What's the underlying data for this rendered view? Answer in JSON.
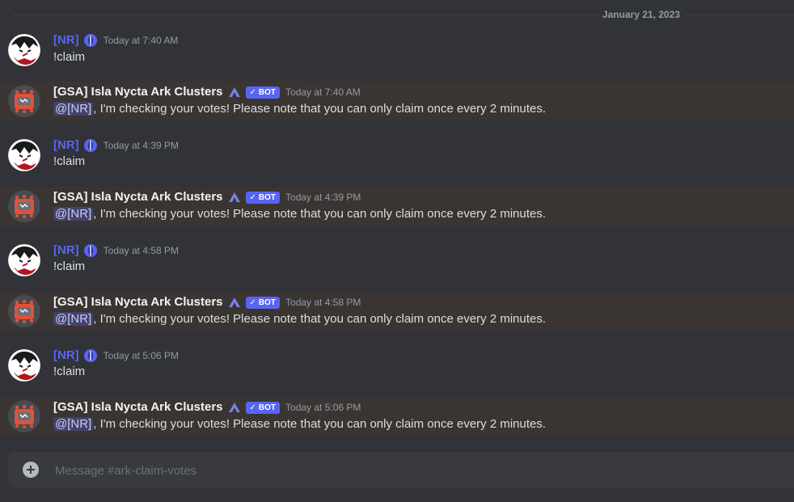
{
  "chat": {
    "date_divider": "January 21, 2023",
    "messages": [
      {
        "author": "[NR]",
        "time": "Today at 7:40 AM",
        "text": "!claim",
        "is_bot": false
      },
      {
        "author": "[GSA] Isla Nycta Ark Clusters",
        "bot_tag": "BOT",
        "time": "Today at 7:40 AM",
        "mention": "@[NR]",
        "text": ", I'm checking your votes! Please note that you can only claim once every 2 minutes.",
        "is_bot": true
      },
      {
        "author": "[NR]",
        "time": "Today at 4:39 PM",
        "text": "!claim",
        "is_bot": false
      },
      {
        "author": "[GSA] Isla Nycta Ark Clusters",
        "bot_tag": "BOT",
        "time": "Today at 4:39 PM",
        "mention": "@[NR]",
        "text": ", I'm checking your votes! Please note that you can only claim once every 2 minutes.",
        "is_bot": true
      },
      {
        "author": "[NR]",
        "time": "Today at 4:58 PM",
        "text": "!claim",
        "is_bot": false
      },
      {
        "author": "[GSA] Isla Nycta Ark Clusters",
        "bot_tag": "BOT",
        "time": "Today at 4:58 PM",
        "mention": "@[NR]",
        "text": ", I'm checking your votes! Please note that you can only claim once every 2 minutes.",
        "is_bot": true
      },
      {
        "author": "[NR]",
        "time": "Today at 5:06 PM",
        "text": "!claim",
        "is_bot": false
      },
      {
        "author": "[GSA] Isla Nycta Ark Clusters",
        "bot_tag": "BOT",
        "time": "Today at 5:06 PM",
        "mention": "@[NR]",
        "text": ", I'm checking your votes! Please note that you can only claim once every 2 minutes.",
        "is_bot": true
      }
    ]
  },
  "composer": {
    "placeholder": "Message #ark-claim-votes",
    "add_icon": "plus-circle-icon"
  },
  "colors": {
    "background": "#313338",
    "mention_highlight_row": "#3a3532",
    "user_name": "#5865f2",
    "bot_tag": "#5865f2"
  }
}
